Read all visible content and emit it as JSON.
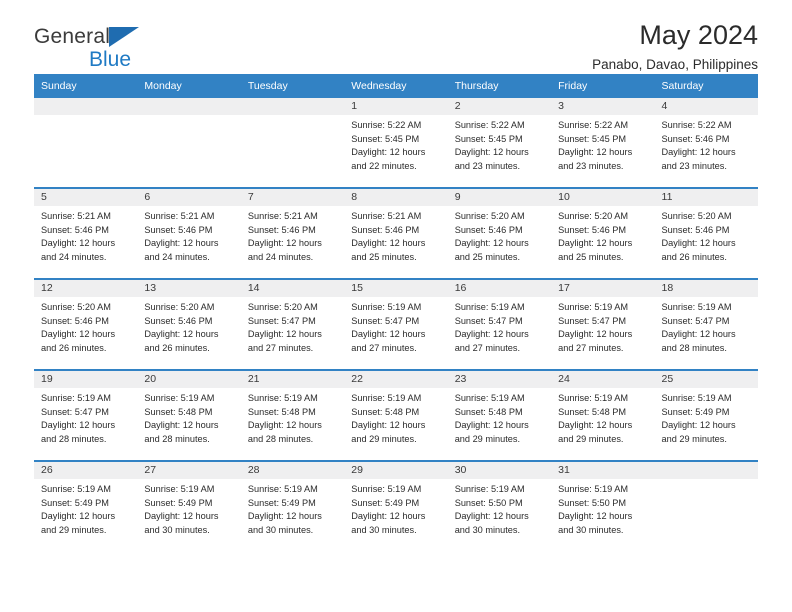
{
  "brand": {
    "name_top": "General",
    "name_bottom": "Blue",
    "triangle_color": "#1f6cb0",
    "blue_text_color": "#1f7ac4"
  },
  "header": {
    "title": "May 2024",
    "subtitle": "Panabo, Davao, Philippines"
  },
  "theme": {
    "header_bg": "#3282c4",
    "daynum_bg": "#efeff0",
    "text": "#2b2b2b"
  },
  "weekday_headers": [
    "Sunday",
    "Monday",
    "Tuesday",
    "Wednesday",
    "Thursday",
    "Friday",
    "Saturday"
  ],
  "weeks": [
    [
      {
        "day": ""
      },
      {
        "day": ""
      },
      {
        "day": ""
      },
      {
        "day": "1",
        "sunrise": "Sunrise: 5:22 AM",
        "sunset": "Sunset: 5:45 PM",
        "daylight_1": "Daylight: 12 hours",
        "daylight_2": "and 22 minutes."
      },
      {
        "day": "2",
        "sunrise": "Sunrise: 5:22 AM",
        "sunset": "Sunset: 5:45 PM",
        "daylight_1": "Daylight: 12 hours",
        "daylight_2": "and 23 minutes."
      },
      {
        "day": "3",
        "sunrise": "Sunrise: 5:22 AM",
        "sunset": "Sunset: 5:45 PM",
        "daylight_1": "Daylight: 12 hours",
        "daylight_2": "and 23 minutes."
      },
      {
        "day": "4",
        "sunrise": "Sunrise: 5:22 AM",
        "sunset": "Sunset: 5:46 PM",
        "daylight_1": "Daylight: 12 hours",
        "daylight_2": "and 23 minutes."
      }
    ],
    [
      {
        "day": "5",
        "sunrise": "Sunrise: 5:21 AM",
        "sunset": "Sunset: 5:46 PM",
        "daylight_1": "Daylight: 12 hours",
        "daylight_2": "and 24 minutes."
      },
      {
        "day": "6",
        "sunrise": "Sunrise: 5:21 AM",
        "sunset": "Sunset: 5:46 PM",
        "daylight_1": "Daylight: 12 hours",
        "daylight_2": "and 24 minutes."
      },
      {
        "day": "7",
        "sunrise": "Sunrise: 5:21 AM",
        "sunset": "Sunset: 5:46 PM",
        "daylight_1": "Daylight: 12 hours",
        "daylight_2": "and 24 minutes."
      },
      {
        "day": "8",
        "sunrise": "Sunrise: 5:21 AM",
        "sunset": "Sunset: 5:46 PM",
        "daylight_1": "Daylight: 12 hours",
        "daylight_2": "and 25 minutes."
      },
      {
        "day": "9",
        "sunrise": "Sunrise: 5:20 AM",
        "sunset": "Sunset: 5:46 PM",
        "daylight_1": "Daylight: 12 hours",
        "daylight_2": "and 25 minutes."
      },
      {
        "day": "10",
        "sunrise": "Sunrise: 5:20 AM",
        "sunset": "Sunset: 5:46 PM",
        "daylight_1": "Daylight: 12 hours",
        "daylight_2": "and 25 minutes."
      },
      {
        "day": "11",
        "sunrise": "Sunrise: 5:20 AM",
        "sunset": "Sunset: 5:46 PM",
        "daylight_1": "Daylight: 12 hours",
        "daylight_2": "and 26 minutes."
      }
    ],
    [
      {
        "day": "12",
        "sunrise": "Sunrise: 5:20 AM",
        "sunset": "Sunset: 5:46 PM",
        "daylight_1": "Daylight: 12 hours",
        "daylight_2": "and 26 minutes."
      },
      {
        "day": "13",
        "sunrise": "Sunrise: 5:20 AM",
        "sunset": "Sunset: 5:46 PM",
        "daylight_1": "Daylight: 12 hours",
        "daylight_2": "and 26 minutes."
      },
      {
        "day": "14",
        "sunrise": "Sunrise: 5:20 AM",
        "sunset": "Sunset: 5:47 PM",
        "daylight_1": "Daylight: 12 hours",
        "daylight_2": "and 27 minutes."
      },
      {
        "day": "15",
        "sunrise": "Sunrise: 5:19 AM",
        "sunset": "Sunset: 5:47 PM",
        "daylight_1": "Daylight: 12 hours",
        "daylight_2": "and 27 minutes."
      },
      {
        "day": "16",
        "sunrise": "Sunrise: 5:19 AM",
        "sunset": "Sunset: 5:47 PM",
        "daylight_1": "Daylight: 12 hours",
        "daylight_2": "and 27 minutes."
      },
      {
        "day": "17",
        "sunrise": "Sunrise: 5:19 AM",
        "sunset": "Sunset: 5:47 PM",
        "daylight_1": "Daylight: 12 hours",
        "daylight_2": "and 27 minutes."
      },
      {
        "day": "18",
        "sunrise": "Sunrise: 5:19 AM",
        "sunset": "Sunset: 5:47 PM",
        "daylight_1": "Daylight: 12 hours",
        "daylight_2": "and 28 minutes."
      }
    ],
    [
      {
        "day": "19",
        "sunrise": "Sunrise: 5:19 AM",
        "sunset": "Sunset: 5:47 PM",
        "daylight_1": "Daylight: 12 hours",
        "daylight_2": "and 28 minutes."
      },
      {
        "day": "20",
        "sunrise": "Sunrise: 5:19 AM",
        "sunset": "Sunset: 5:48 PM",
        "daylight_1": "Daylight: 12 hours",
        "daylight_2": "and 28 minutes."
      },
      {
        "day": "21",
        "sunrise": "Sunrise: 5:19 AM",
        "sunset": "Sunset: 5:48 PM",
        "daylight_1": "Daylight: 12 hours",
        "daylight_2": "and 28 minutes."
      },
      {
        "day": "22",
        "sunrise": "Sunrise: 5:19 AM",
        "sunset": "Sunset: 5:48 PM",
        "daylight_1": "Daylight: 12 hours",
        "daylight_2": "and 29 minutes."
      },
      {
        "day": "23",
        "sunrise": "Sunrise: 5:19 AM",
        "sunset": "Sunset: 5:48 PM",
        "daylight_1": "Daylight: 12 hours",
        "daylight_2": "and 29 minutes."
      },
      {
        "day": "24",
        "sunrise": "Sunrise: 5:19 AM",
        "sunset": "Sunset: 5:48 PM",
        "daylight_1": "Daylight: 12 hours",
        "daylight_2": "and 29 minutes."
      },
      {
        "day": "25",
        "sunrise": "Sunrise: 5:19 AM",
        "sunset": "Sunset: 5:49 PM",
        "daylight_1": "Daylight: 12 hours",
        "daylight_2": "and 29 minutes."
      }
    ],
    [
      {
        "day": "26",
        "sunrise": "Sunrise: 5:19 AM",
        "sunset": "Sunset: 5:49 PM",
        "daylight_1": "Daylight: 12 hours",
        "daylight_2": "and 29 minutes."
      },
      {
        "day": "27",
        "sunrise": "Sunrise: 5:19 AM",
        "sunset": "Sunset: 5:49 PM",
        "daylight_1": "Daylight: 12 hours",
        "daylight_2": "and 30 minutes."
      },
      {
        "day": "28",
        "sunrise": "Sunrise: 5:19 AM",
        "sunset": "Sunset: 5:49 PM",
        "daylight_1": "Daylight: 12 hours",
        "daylight_2": "and 30 minutes."
      },
      {
        "day": "29",
        "sunrise": "Sunrise: 5:19 AM",
        "sunset": "Sunset: 5:49 PM",
        "daylight_1": "Daylight: 12 hours",
        "daylight_2": "and 30 minutes."
      },
      {
        "day": "30",
        "sunrise": "Sunrise: 5:19 AM",
        "sunset": "Sunset: 5:50 PM",
        "daylight_1": "Daylight: 12 hours",
        "daylight_2": "and 30 minutes."
      },
      {
        "day": "31",
        "sunrise": "Sunrise: 5:19 AM",
        "sunset": "Sunset: 5:50 PM",
        "daylight_1": "Daylight: 12 hours",
        "daylight_2": "and 30 minutes."
      },
      {
        "day": ""
      }
    ]
  ]
}
